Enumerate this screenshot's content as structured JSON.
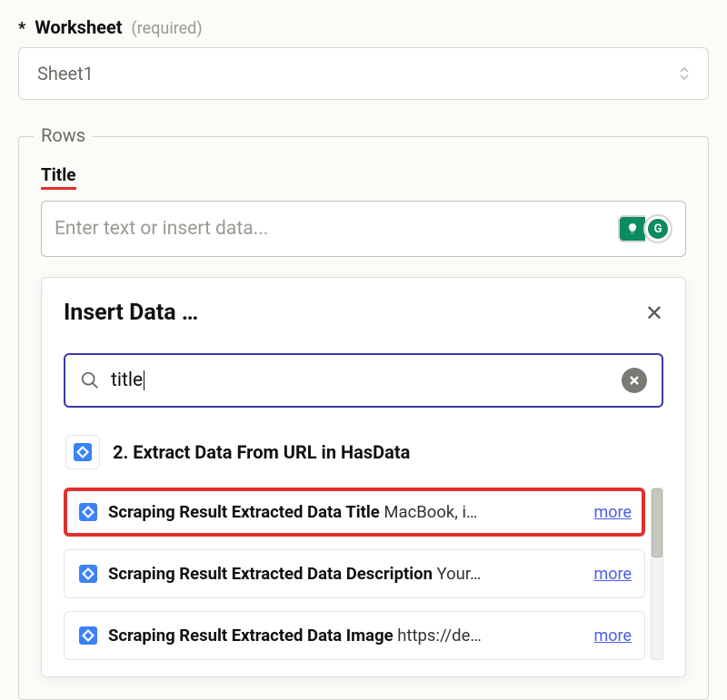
{
  "worksheet": {
    "asterisk": "*",
    "label": "Worksheet",
    "required_text": "(required)",
    "value": "Sheet1"
  },
  "rows": {
    "legend": "Rows",
    "title_label": "Title",
    "title_placeholder": "Enter text or insert data...",
    "grammarly_letter": "G"
  },
  "popup": {
    "title": "Insert Data …",
    "search_value": "title",
    "step": {
      "label": "2. Extract Data From URL in HasData"
    },
    "results": [
      {
        "name": "Scraping Result Extracted Data Title",
        "preview": " MacBook, i…",
        "more": "more"
      },
      {
        "name": "Scraping Result Extracted Data Description",
        "preview": " Your…",
        "more": "more"
      },
      {
        "name": "Scraping Result Extracted Data Image",
        "preview": " https://de…",
        "more": "more"
      }
    ]
  }
}
